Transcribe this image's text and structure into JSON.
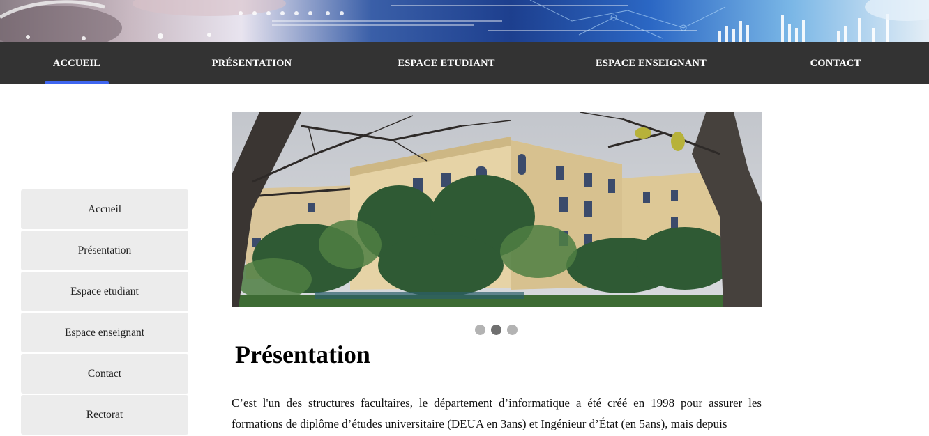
{
  "navbar": {
    "items": [
      {
        "label": "ACCUEIL",
        "active": true
      },
      {
        "label": "PRÉSENTATION",
        "active": false
      },
      {
        "label": "ESPACE ETUDIANT",
        "active": false
      },
      {
        "label": "ESPACE ENSEIGNANT",
        "active": false
      },
      {
        "label": "CONTACT",
        "active": false
      }
    ],
    "active_color": "#3f66f0",
    "background": "#333333"
  },
  "sidebar": {
    "items": [
      {
        "label": "Accueil"
      },
      {
        "label": "Présentation"
      },
      {
        "label": "Espace etudiant"
      },
      {
        "label": "Espace enseignant"
      },
      {
        "label": "Contact"
      },
      {
        "label": "Rectorat"
      }
    ]
  },
  "slider": {
    "slide_count": 3,
    "active_index": 1
  },
  "main": {
    "title": "Présentation",
    "paragraph": "C’est l'un des structures facultaires, le département d’informatique a été créé en 1998 pour assurer les formations de diplôme d’études universitaire (DEUA en 3ans) et Ingénieur d’État (en 5ans), mais depuis"
  }
}
